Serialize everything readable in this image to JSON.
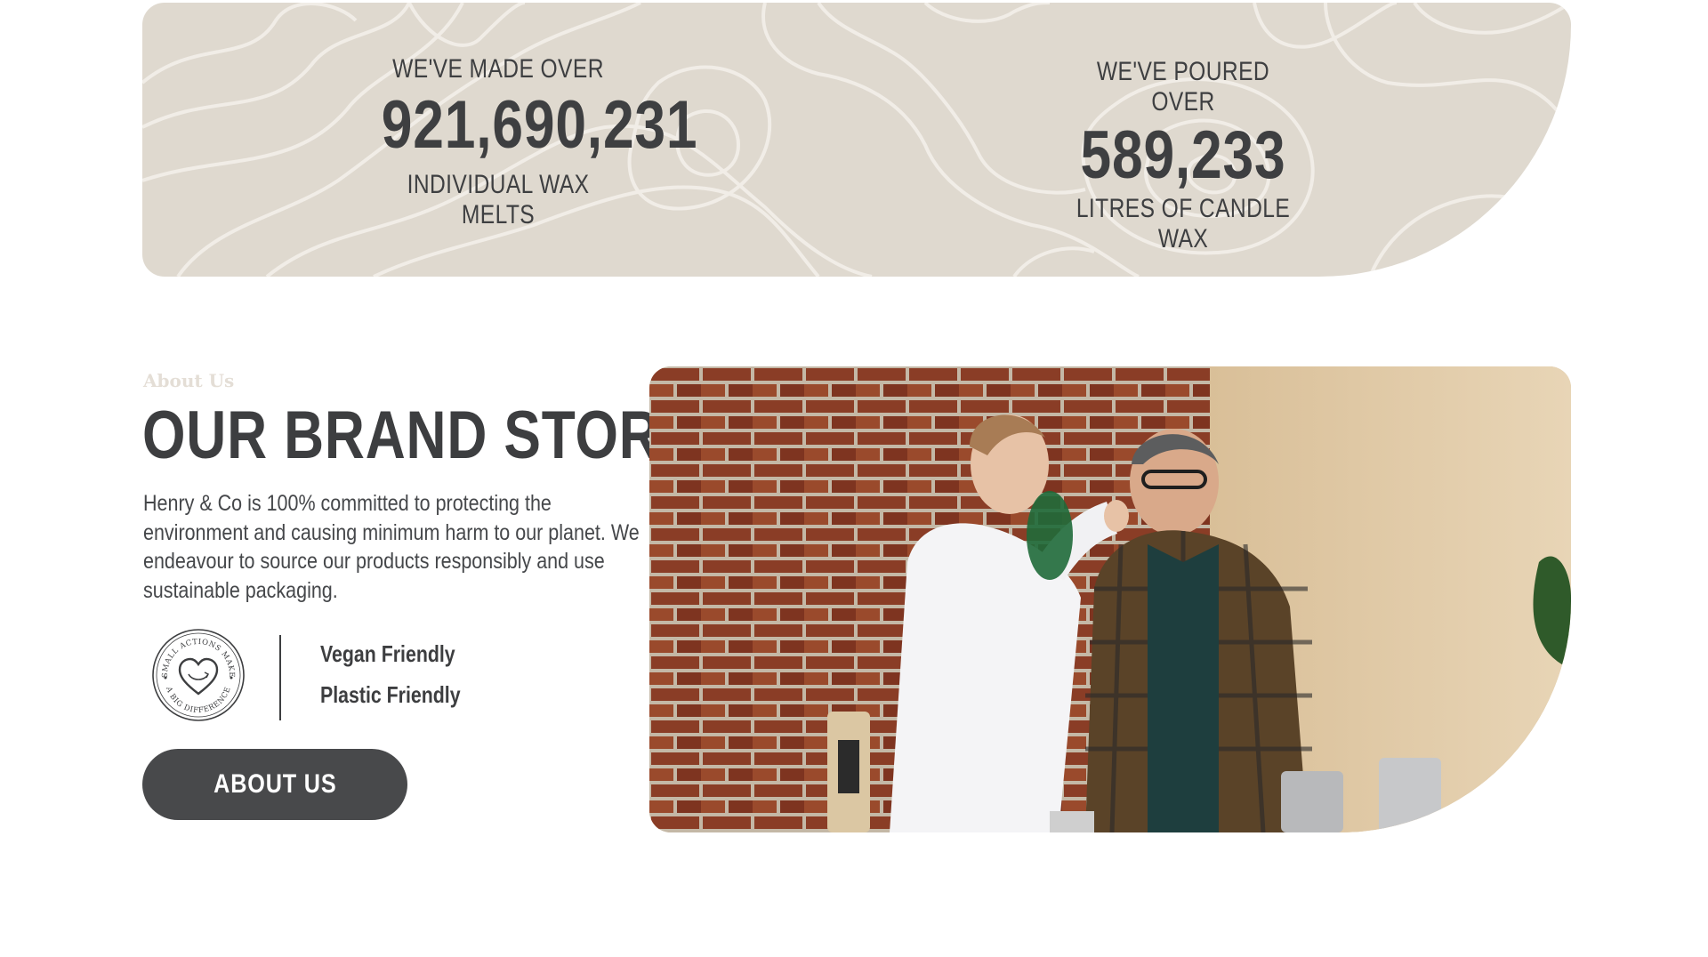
{
  "stats": [
    {
      "pre": "WE'VE MADE OVER",
      "number": "921,690,231",
      "post": "INDIVIDUAL WAX MELTS"
    },
    {
      "pre": "WE'VE POURED OVER",
      "number": "589,233",
      "post": "LITRES OF CANDLE WAX"
    }
  ],
  "about": {
    "eyebrow": "About Us",
    "title": "OUR BRAND STORY",
    "body": "Henry & Co is 100% committed to protecting the environment and causing minimum harm to our planet. We endeavour to source our products responsibly and use sustainable packaging.",
    "badge": {
      "top_text": "SMALL ACTIONS MAKE",
      "bottom_text": "A BIG DIFFERENCE"
    },
    "features": [
      "Vegan Friendly",
      "Plastic Friendly"
    ],
    "button_label": "ABOUT US"
  },
  "colors": {
    "banner": "#dfd9cf",
    "dark": "#3d3e40",
    "button": "#48494b",
    "eyebrow": "#e4ded6"
  },
  "image": {
    "description_icon": "photo-people-candle-making"
  }
}
